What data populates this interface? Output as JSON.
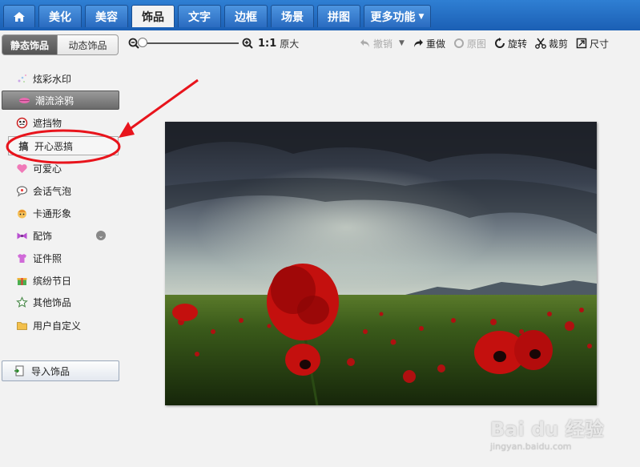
{
  "nav": {
    "tabs": [
      {
        "label": ""
      },
      {
        "label": "美化"
      },
      {
        "label": "美容"
      },
      {
        "label": "饰品"
      },
      {
        "label": "文字"
      },
      {
        "label": "边框"
      },
      {
        "label": "场景"
      },
      {
        "label": "拼图"
      },
      {
        "label": "更多功能"
      }
    ],
    "active_tab": "饰品"
  },
  "subtabs": {
    "static": "静态饰品",
    "dynamic": "动态饰品"
  },
  "zoom": {
    "ratio_label": "1:1",
    "original_label": "原大",
    "level": 0.0
  },
  "toolbar": {
    "undo": "撤销",
    "redo": "重做",
    "original": "原图",
    "rotate": "旋转",
    "crop": "裁剪",
    "size": "尺寸"
  },
  "sidebar": {
    "items": [
      {
        "label": "炫彩水印",
        "icon": "sparkle-icon"
      },
      {
        "label": "潮流涂鸦",
        "icon": "lips-icon"
      },
      {
        "label": "遮挡物",
        "icon": "mask-icon"
      },
      {
        "label": "开心恶搞",
        "icon": "gao-char-icon"
      },
      {
        "label": "可爱心",
        "icon": "heart-icon"
      },
      {
        "label": "会话气泡",
        "icon": "speech-bubble-icon"
      },
      {
        "label": "卡通形象",
        "icon": "cartoon-face-icon"
      },
      {
        "label": "配饰",
        "icon": "bow-icon"
      },
      {
        "label": "证件照",
        "icon": "shirt-icon"
      },
      {
        "label": "缤纷节日",
        "icon": "gift-icon"
      },
      {
        "label": "其他饰品",
        "icon": "star-outline-icon"
      },
      {
        "label": "用户自定义",
        "icon": "folder-icon"
      }
    ],
    "selected_index": 1,
    "highlighted_index": 3,
    "import_label": "导入饰品"
  },
  "watermark": {
    "logo": "Bai du 经验",
    "url": "jingyan.baidu.com"
  },
  "colors": {
    "topbar": "#1b5fb4",
    "annotation": "#e8141c"
  }
}
